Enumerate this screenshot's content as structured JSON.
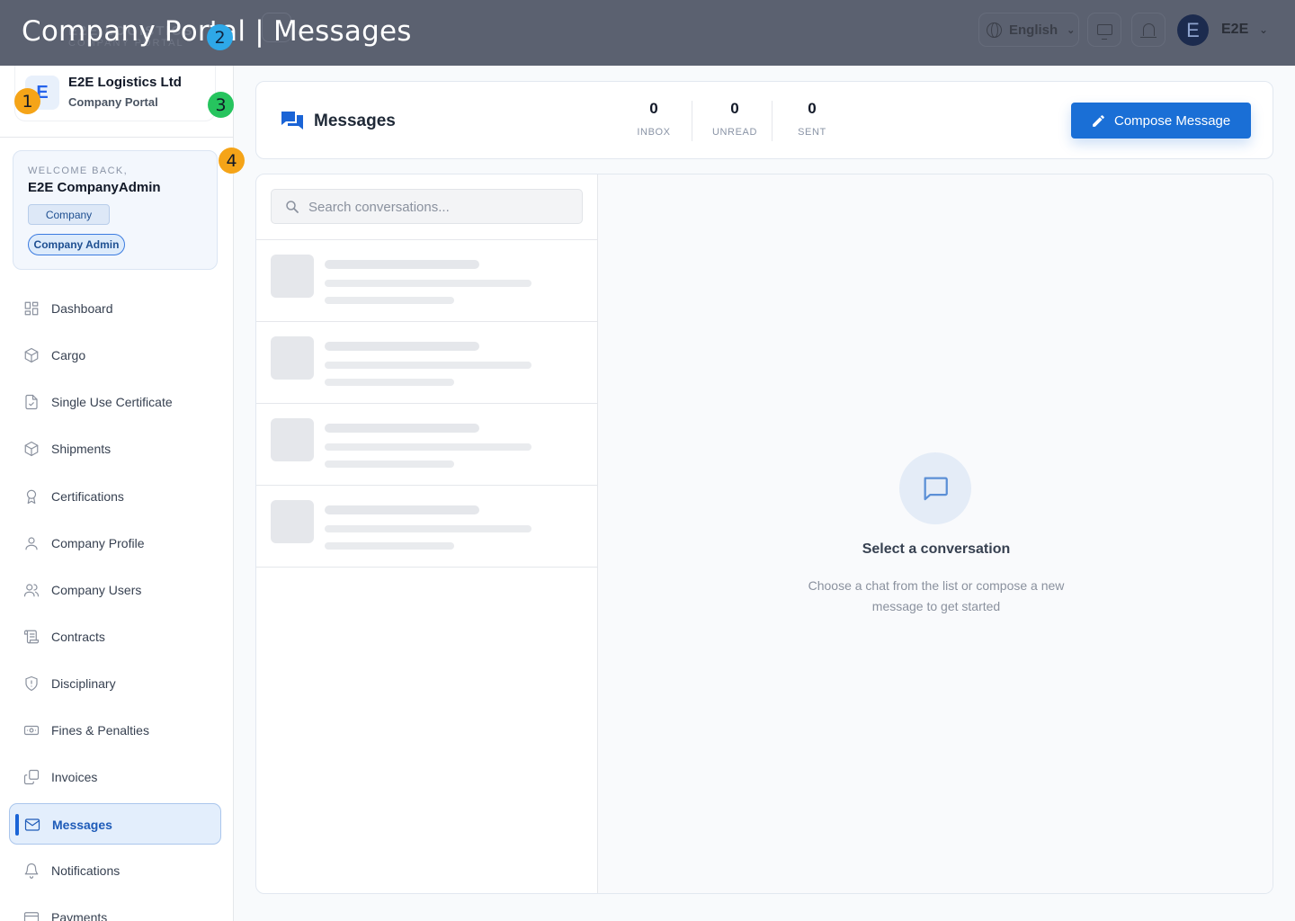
{
  "overlay": {
    "title": "Company Portal | Messages",
    "ghost_brand": "E2E LOGISTICS",
    "ghost_sub": "COMPANY PORTAL"
  },
  "topbar": {
    "language": "English",
    "user_initial": "E",
    "user_name": "E2E"
  },
  "org": {
    "logo_letter": "E",
    "name": "E2E Logistics Ltd",
    "subtitle": "Company Portal"
  },
  "welcome": {
    "label": "WELCOME BACK,",
    "user": "E2E CompanyAdmin",
    "role": "Company",
    "badge": "Company Admin"
  },
  "sidebar": {
    "items": [
      {
        "label": "Dashboard",
        "icon": "dashboard-icon"
      },
      {
        "label": "Cargo",
        "icon": "package-icon"
      },
      {
        "label": "Single Use Certificate",
        "icon": "file-check-icon"
      },
      {
        "label": "Shipments",
        "icon": "package-icon"
      },
      {
        "label": "Certifications",
        "icon": "award-icon"
      },
      {
        "label": "Company Profile",
        "icon": "user-icon"
      },
      {
        "label": "Company Users",
        "icon": "users-icon"
      },
      {
        "label": "Contracts",
        "icon": "scroll-icon"
      },
      {
        "label": "Disciplinary",
        "icon": "shield-alert-icon"
      },
      {
        "label": "Fines & Penalties",
        "icon": "banknote-icon"
      },
      {
        "label": "Invoices",
        "icon": "copy-icon"
      },
      {
        "label": "Messages",
        "icon": "mail-icon",
        "active": true
      },
      {
        "label": "Notifications",
        "icon": "bell-icon"
      },
      {
        "label": "Payments",
        "icon": "credit-card-icon"
      }
    ]
  },
  "markers": [
    "1",
    "2",
    "3",
    "4"
  ],
  "header": {
    "title": "Messages",
    "stats": [
      {
        "value": "0",
        "label": "INBOX"
      },
      {
        "value": "0",
        "label": "UNREAD"
      },
      {
        "value": "0",
        "label": "SENT"
      }
    ],
    "compose_label": "Compose Message"
  },
  "search": {
    "placeholder": "Search conversations..."
  },
  "empty_state": {
    "title": "Select a conversation",
    "description": "Choose a chat from the list or compose a new message to get started"
  },
  "colors": {
    "accent": "#1a6fd6",
    "active_bg": "#e3eefc",
    "overlay": "#5b6170"
  }
}
